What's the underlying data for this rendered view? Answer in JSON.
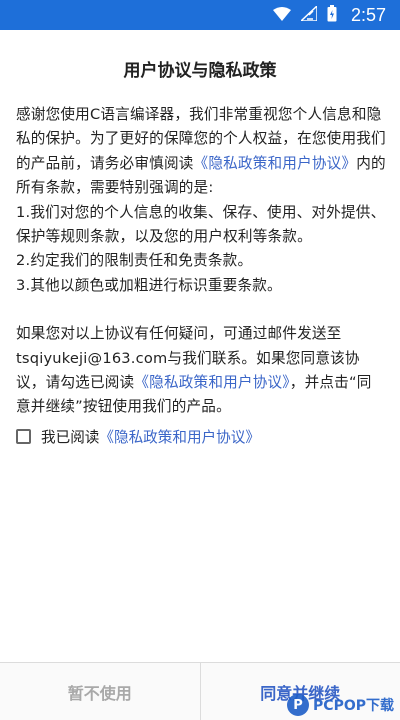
{
  "status_bar": {
    "time": "2:57",
    "icons": [
      "wifi-icon",
      "signal-icon",
      "battery-icon"
    ]
  },
  "title": "用户协议与隐私政策",
  "body": {
    "p1_pre": "感谢您使用C语言编译器，我们非常重视您个人信息和隐私的保护。为了更好的保障您的个人权益，在您使用我们的产品前，请务必审慎阅读",
    "p1_link": "《隐私政策和用户协议》",
    "p1_post": "内的所有条款，需要特别强调的是:",
    "item1": "1.我们对您的个人信息的收集、保存、使用、对外提供、保护等规则条款，以及您的用户权利等条款。",
    "item2": "2.约定我们的限制责任和免责条款。",
    "item3": "3.其他以颜色或加粗进行标识重要条款。",
    "p2_pre": "如果您对以上协议有任何疑问，可通过邮件发送至tsqiyukeji@163.com与我们联系。如果您同意该协议，请勾选已阅读",
    "p2_link": "《隐私政策和用户协议》",
    "p2_post": "，并点击“同意并继续”按钮使用我们的产品。"
  },
  "agree": {
    "label": "我已阅读",
    "link": "《隐私政策和用户协议》",
    "checked": false
  },
  "buttons": {
    "decline": "暂不使用",
    "accept": "同意并继续"
  },
  "watermark": {
    "logo": "P",
    "text": "PCPOP下载"
  },
  "colors": {
    "status_bar": "#1e6fd9",
    "link": "#3b66c8",
    "disabled": "#a9a9a9"
  }
}
